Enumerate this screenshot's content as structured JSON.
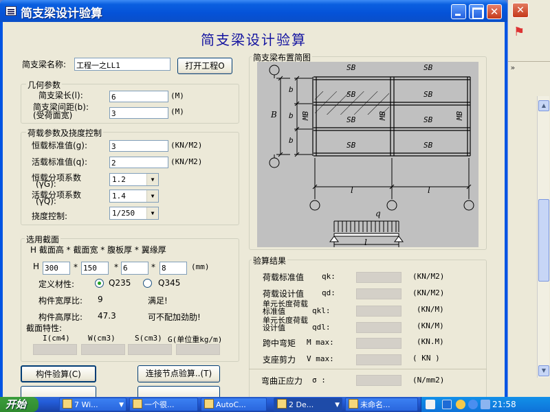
{
  "window": {
    "title": "简支梁设计验算",
    "heading": "简支梁设计验算"
  },
  "beam_name": {
    "label": "简支梁名称:",
    "value": "工程一之LL1",
    "open_button": "打开工程O"
  },
  "geometry": {
    "group_title": "几何参数",
    "span_label": "简支梁长(l):",
    "span_value": "6",
    "span_unit": "(M)",
    "spacing_label_1": "简支梁间距(b):",
    "spacing_label_2": "(受荷面宽)",
    "spacing_value": "3",
    "spacing_unit": "(M)"
  },
  "loads": {
    "group_title": "荷载参数及挠度控制",
    "dead_label": "恒载标准值(g):",
    "dead_value": "3",
    "dead_unit": "(KN/M2)",
    "live_label": "活载标准值(q):",
    "live_value": "2",
    "live_unit": "(KN/M2)",
    "dead_factor_label_1": "恒载分项系数",
    "dead_factor_label_2": "(γG):",
    "dead_factor_value": "1.2",
    "live_factor_label_1": "活载分项系数",
    "live_factor_label_2": "(γQ):",
    "live_factor_value": "1.4",
    "deflection_label": "挠度控制:",
    "deflection_value": "1/250"
  },
  "section": {
    "group_title": "选用截面",
    "formula": "H 截面高 * 截面宽 * 腹板厚 * 翼缘厚",
    "h_label": "H",
    "height": "300",
    "width": "150",
    "web": "6",
    "flange": "8",
    "star": "*",
    "unit": "(mm)",
    "material_label": "定义材性:",
    "q235_label": "Q235",
    "q345_label": "Q345",
    "selected_material": "Q235",
    "width_thick_label": "构件宽厚比:",
    "width_thick_value": "9",
    "width_thick_status": "满足!",
    "height_thick_label": "构件高厚比:",
    "height_thick_value": "47.3",
    "height_thick_status": "可不配加劲肋!",
    "props_title": "截面特性:",
    "props": [
      "I(cm4)",
      "W(cm3)",
      "S(cm3)",
      "G(单位重kg/m)"
    ]
  },
  "buttons": {
    "member_check": "构件验算(C)",
    "joint_check": "连接节点验算..(T)"
  },
  "diagram": {
    "group_title": "简支梁布置简图",
    "sb": "SB",
    "mb": "MB",
    "b_dim": "b",
    "big_b": "B",
    "l_dim": "l",
    "q_label": "q"
  },
  "results": {
    "group_title": "验算结果",
    "rows": [
      {
        "label": "荷载标准值",
        "sym": "qk:",
        "unit": "(KN/M2)"
      },
      {
        "label": "荷载设计值",
        "sym": "qd:",
        "unit": "(KN/M2)"
      },
      {
        "label": "单元长度荷载标准值",
        "sym": "qkl:",
        "unit": "(KN/M)"
      },
      {
        "label": "单元长度荷载设计值",
        "sym": "qdl:",
        "unit": "(KN/M)"
      },
      {
        "label": "跨中弯矩",
        "sym": "M max:",
        "unit": "(KN.M)"
      },
      {
        "label": "支座剪力",
        "sym": "V max:",
        "unit": "( KN )"
      },
      {
        "label": "弯曲正应力",
        "sym": "σ :",
        "unit": "(N/mm2)"
      }
    ]
  },
  "taskbar": {
    "start": "开始",
    "tasks": [
      "7 Wi...",
      "一个很...",
      "AutoC...",
      "2 De...",
      "未命名..."
    ],
    "clock": "21:58"
  }
}
